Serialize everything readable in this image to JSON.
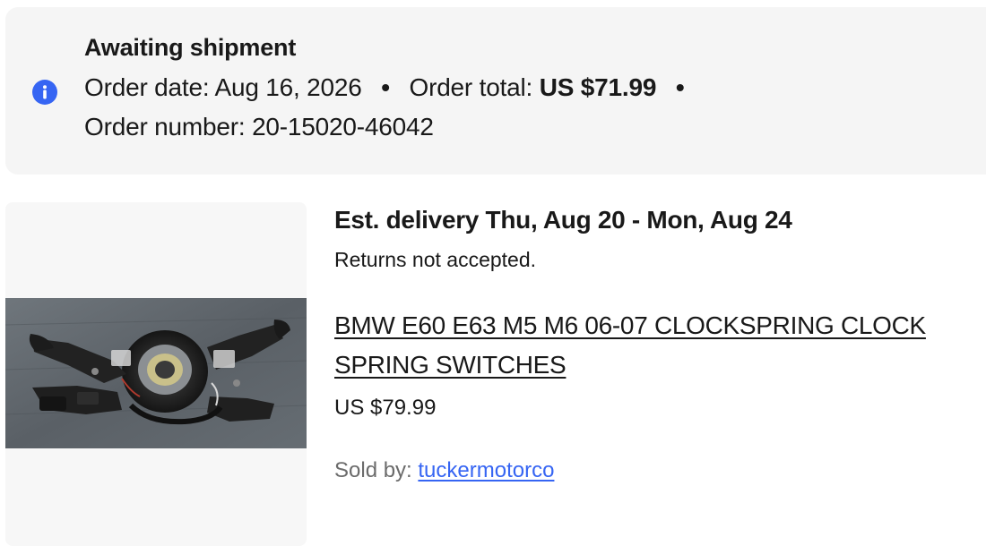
{
  "status": {
    "title": "Awaiting shipment",
    "icon": "info-icon",
    "icon_color": "#3665f3",
    "order_date_label": "Order date:",
    "order_date": "Aug 16, 2026",
    "order_total_label": "Order total:",
    "order_total": "US $71.99",
    "order_number_label": "Order number:",
    "order_number": "20-15020-46042",
    "separator": "•"
  },
  "item": {
    "image_icon": "clockspring-photo",
    "delivery": "Est. delivery Thu, Aug 20 - Mon, Aug 24",
    "returns": "Returns not accepted.",
    "title": "BMW E60 E63 M5 M6 06-07 CLOCKSPRING CLOCK SPRING SWITCHES",
    "price": "US $79.99",
    "seller_label": "Sold by:",
    "seller_name": "tuckermotorco",
    "link_color": "#3665f3"
  }
}
